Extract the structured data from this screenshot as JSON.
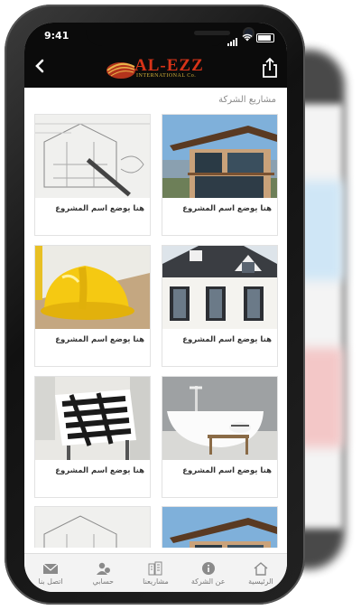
{
  "status": {
    "time": "9:41"
  },
  "header": {
    "brand": "AL-EZZ",
    "brand_sub": "INTERNATIONAL Co."
  },
  "section_title": "مشاريع الشركة",
  "projects": [
    {
      "caption": "هنا يوضع اسم المشروع"
    },
    {
      "caption": "هنا يوضع اسم المشروع"
    },
    {
      "caption": "هنا يوضع اسم المشروع"
    },
    {
      "caption": "هنا يوضع اسم المشروع"
    },
    {
      "caption": "هنا يوضع اسم المشروع"
    },
    {
      "caption": "هنا يوضع اسم المشروع"
    }
  ],
  "tabs": [
    {
      "label": "الرئيسية",
      "icon": "home-icon"
    },
    {
      "label": "عن الشركة",
      "icon": "info-icon"
    },
    {
      "label": "مشاريعنا",
      "icon": "buildings-icon"
    },
    {
      "label": "حسابي",
      "icon": "account-icon"
    },
    {
      "label": "اتصل بنا",
      "icon": "mail-icon"
    }
  ],
  "colors": {
    "header_bg": "#0b0b0b",
    "brand_red": "#d63318",
    "brand_gold": "#d5b33a",
    "tabbar_bg": "#f3f3f3"
  }
}
